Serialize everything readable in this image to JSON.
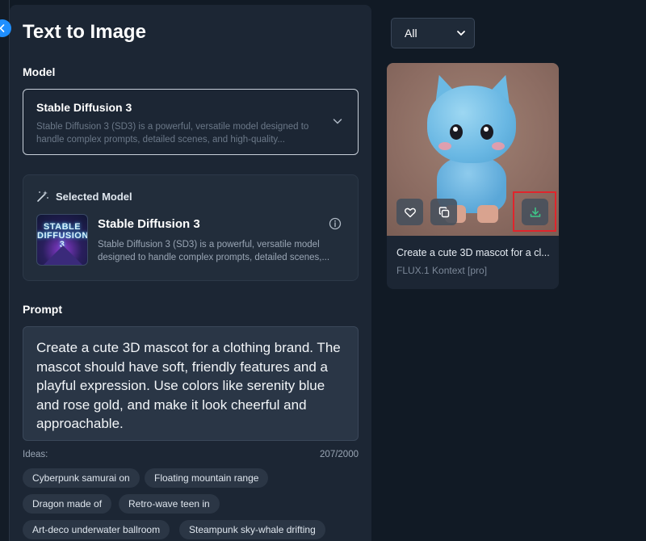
{
  "page": {
    "title": "Text to Image"
  },
  "model": {
    "section_label": "Model",
    "selected_name": "Stable Diffusion 3",
    "selected_desc": "Stable Diffusion 3 (SD3) is a powerful, versatile model designed to handle complex prompts, detailed scenes, and high-quality...",
    "chevron_icon": "chevron-down-icon"
  },
  "selected_model": {
    "header": "Selected Model",
    "thumb_text": "STABLE DIFFUSION 3",
    "name": "Stable Diffusion 3",
    "desc": "Stable Diffusion 3 (SD3) is a powerful, versatile model designed to handle complex prompts, detailed scenes,...",
    "icon": "magic-wand-icon",
    "info_icon": "info-icon"
  },
  "prompt": {
    "section_label": "Prompt",
    "value": "Create a cute 3D mascot for a clothing brand. The mascot should have soft, friendly features and a playful expression. Use colors like serenity blue and rose gold, and make it look cheerful and approachable.",
    "ideas_label": "Ideas:",
    "char_count": "207/2000"
  },
  "ideas": [
    "Cyberpunk samurai on",
    "Floating mountain range",
    "Dragon made of",
    "Retro-wave teen in",
    "Art-deco underwater ballroom",
    "Steampunk sky-whale drifting"
  ],
  "filter": {
    "value": "All"
  },
  "results": [
    {
      "caption": "Create a cute 3D mascot for a cl...",
      "model": "FLUX.1 Kontext [pro]"
    }
  ],
  "colors": {
    "background": "#111a25",
    "panel": "#1c2634",
    "accent": "#1f8fff",
    "highlight": "#e0252c",
    "download_icon": "#3ec98a"
  }
}
